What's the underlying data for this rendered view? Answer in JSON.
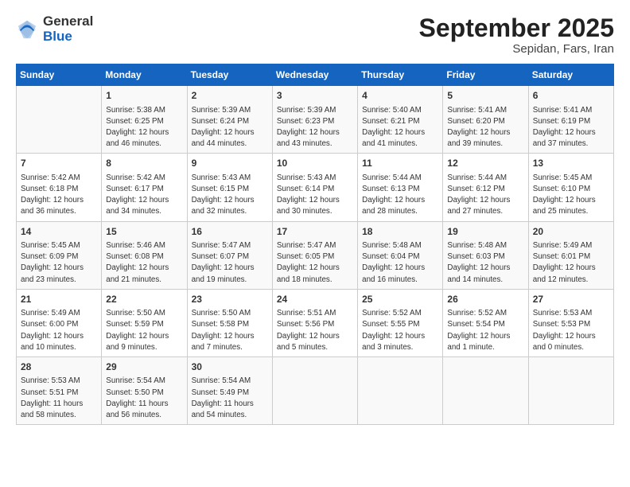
{
  "logo": {
    "general": "General",
    "blue": "Blue"
  },
  "title": "September 2025",
  "location": "Sepidan, Fars, Iran",
  "days_header": [
    "Sunday",
    "Monday",
    "Tuesday",
    "Wednesday",
    "Thursday",
    "Friday",
    "Saturday"
  ],
  "weeks": [
    [
      {
        "day": "",
        "content": ""
      },
      {
        "day": "1",
        "content": "Sunrise: 5:38 AM\nSunset: 6:25 PM\nDaylight: 12 hours\nand 46 minutes."
      },
      {
        "day": "2",
        "content": "Sunrise: 5:39 AM\nSunset: 6:24 PM\nDaylight: 12 hours\nand 44 minutes."
      },
      {
        "day": "3",
        "content": "Sunrise: 5:39 AM\nSunset: 6:23 PM\nDaylight: 12 hours\nand 43 minutes."
      },
      {
        "day": "4",
        "content": "Sunrise: 5:40 AM\nSunset: 6:21 PM\nDaylight: 12 hours\nand 41 minutes."
      },
      {
        "day": "5",
        "content": "Sunrise: 5:41 AM\nSunset: 6:20 PM\nDaylight: 12 hours\nand 39 minutes."
      },
      {
        "day": "6",
        "content": "Sunrise: 5:41 AM\nSunset: 6:19 PM\nDaylight: 12 hours\nand 37 minutes."
      }
    ],
    [
      {
        "day": "7",
        "content": "Sunrise: 5:42 AM\nSunset: 6:18 PM\nDaylight: 12 hours\nand 36 minutes."
      },
      {
        "day": "8",
        "content": "Sunrise: 5:42 AM\nSunset: 6:17 PM\nDaylight: 12 hours\nand 34 minutes."
      },
      {
        "day": "9",
        "content": "Sunrise: 5:43 AM\nSunset: 6:15 PM\nDaylight: 12 hours\nand 32 minutes."
      },
      {
        "day": "10",
        "content": "Sunrise: 5:43 AM\nSunset: 6:14 PM\nDaylight: 12 hours\nand 30 minutes."
      },
      {
        "day": "11",
        "content": "Sunrise: 5:44 AM\nSunset: 6:13 PM\nDaylight: 12 hours\nand 28 minutes."
      },
      {
        "day": "12",
        "content": "Sunrise: 5:44 AM\nSunset: 6:12 PM\nDaylight: 12 hours\nand 27 minutes."
      },
      {
        "day": "13",
        "content": "Sunrise: 5:45 AM\nSunset: 6:10 PM\nDaylight: 12 hours\nand 25 minutes."
      }
    ],
    [
      {
        "day": "14",
        "content": "Sunrise: 5:45 AM\nSunset: 6:09 PM\nDaylight: 12 hours\nand 23 minutes."
      },
      {
        "day": "15",
        "content": "Sunrise: 5:46 AM\nSunset: 6:08 PM\nDaylight: 12 hours\nand 21 minutes."
      },
      {
        "day": "16",
        "content": "Sunrise: 5:47 AM\nSunset: 6:07 PM\nDaylight: 12 hours\nand 19 minutes."
      },
      {
        "day": "17",
        "content": "Sunrise: 5:47 AM\nSunset: 6:05 PM\nDaylight: 12 hours\nand 18 minutes."
      },
      {
        "day": "18",
        "content": "Sunrise: 5:48 AM\nSunset: 6:04 PM\nDaylight: 12 hours\nand 16 minutes."
      },
      {
        "day": "19",
        "content": "Sunrise: 5:48 AM\nSunset: 6:03 PM\nDaylight: 12 hours\nand 14 minutes."
      },
      {
        "day": "20",
        "content": "Sunrise: 5:49 AM\nSunset: 6:01 PM\nDaylight: 12 hours\nand 12 minutes."
      }
    ],
    [
      {
        "day": "21",
        "content": "Sunrise: 5:49 AM\nSunset: 6:00 PM\nDaylight: 12 hours\nand 10 minutes."
      },
      {
        "day": "22",
        "content": "Sunrise: 5:50 AM\nSunset: 5:59 PM\nDaylight: 12 hours\nand 9 minutes."
      },
      {
        "day": "23",
        "content": "Sunrise: 5:50 AM\nSunset: 5:58 PM\nDaylight: 12 hours\nand 7 minutes."
      },
      {
        "day": "24",
        "content": "Sunrise: 5:51 AM\nSunset: 5:56 PM\nDaylight: 12 hours\nand 5 minutes."
      },
      {
        "day": "25",
        "content": "Sunrise: 5:52 AM\nSunset: 5:55 PM\nDaylight: 12 hours\nand 3 minutes."
      },
      {
        "day": "26",
        "content": "Sunrise: 5:52 AM\nSunset: 5:54 PM\nDaylight: 12 hours\nand 1 minute."
      },
      {
        "day": "27",
        "content": "Sunrise: 5:53 AM\nSunset: 5:53 PM\nDaylight: 12 hours\nand 0 minutes."
      }
    ],
    [
      {
        "day": "28",
        "content": "Sunrise: 5:53 AM\nSunset: 5:51 PM\nDaylight: 11 hours\nand 58 minutes."
      },
      {
        "day": "29",
        "content": "Sunrise: 5:54 AM\nSunset: 5:50 PM\nDaylight: 11 hours\nand 56 minutes."
      },
      {
        "day": "30",
        "content": "Sunrise: 5:54 AM\nSunset: 5:49 PM\nDaylight: 11 hours\nand 54 minutes."
      },
      {
        "day": "",
        "content": ""
      },
      {
        "day": "",
        "content": ""
      },
      {
        "day": "",
        "content": ""
      },
      {
        "day": "",
        "content": ""
      }
    ]
  ]
}
